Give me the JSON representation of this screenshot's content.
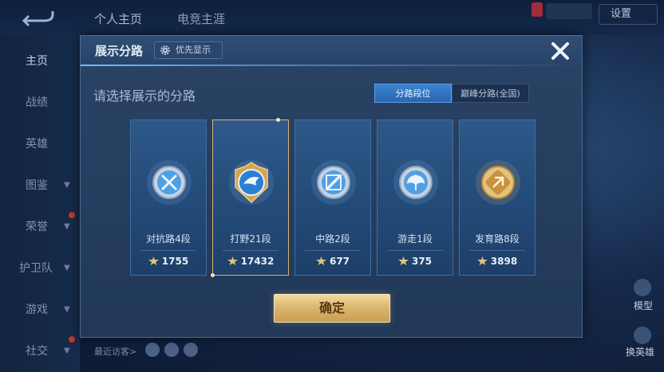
{
  "topbar": {
    "tabs": [
      "个人主页",
      "电竞主涯"
    ],
    "settings_label": "设置"
  },
  "sidebar": {
    "items": [
      {
        "label": "主页",
        "chevron": false
      },
      {
        "label": "战绩",
        "chevron": false
      },
      {
        "label": "英雄",
        "chevron": false
      },
      {
        "label": "图鉴",
        "chevron": true
      },
      {
        "label": "荣誉",
        "chevron": true
      },
      {
        "label": "护卫队",
        "chevron": true
      },
      {
        "label": "游戏",
        "chevron": true
      },
      {
        "label": "社交",
        "chevron": true
      }
    ]
  },
  "footer": {
    "visitors_label": "最近访客>",
    "right_labels": [
      "模型",
      "换英雄"
    ]
  },
  "dialog": {
    "title": "展示分路",
    "priority_label": "优先显示",
    "subtitle": "请选择展示的分路",
    "segments": [
      "分路段位",
      "巅峰分路(全国)"
    ],
    "active_segment": 0,
    "confirm_label": "确定",
    "colors": {
      "accent_blue": "#3c84d0",
      "gold": "#d9b56c",
      "selected_border": "#d8b372"
    }
  },
  "lanes": [
    {
      "name": "对抗路4段",
      "score": "1755",
      "emblem": "clash-lane-emblem",
      "selected": false
    },
    {
      "name": "打野21段",
      "score": "17432",
      "emblem": "jungle-emblem",
      "selected": true
    },
    {
      "name": "中路2段",
      "score": "677",
      "emblem": "mid-lane-emblem",
      "selected": false
    },
    {
      "name": "游走1段",
      "score": "375",
      "emblem": "roam-emblem",
      "selected": false
    },
    {
      "name": "发育路8段",
      "score": "3898",
      "emblem": "farm-lane-emblem",
      "selected": false
    }
  ]
}
